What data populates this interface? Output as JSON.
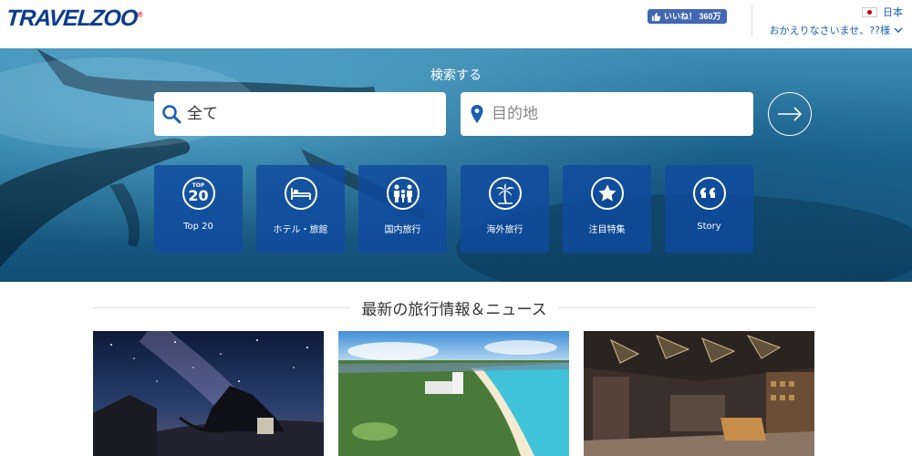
{
  "header": {
    "logo_text": "TRAVELZOO",
    "logo_mark": "®",
    "fb_like": "いいね！ 360万",
    "country": "日本",
    "welcome": "おかえりなさいませ、??様"
  },
  "hero": {
    "search_label": "検索する",
    "keyword_placeholder": "全て",
    "destination_placeholder": "目的地",
    "tiles": [
      {
        "label": "Top 20",
        "icon": "top20-icon",
        "icon_text_top": "TOP",
        "icon_text_num": "20"
      },
      {
        "label": "ホテル・旅館",
        "icon": "bed-icon"
      },
      {
        "label": "国内旅行",
        "icon": "family-icon"
      },
      {
        "label": "海外旅行",
        "icon": "palm-tree-icon"
      },
      {
        "label": "注目特集",
        "icon": "star-icon"
      },
      {
        "label": "Story",
        "icon": "quote-icon"
      }
    ]
  },
  "news": {
    "title": "最新の旅行情報＆ニュース",
    "cards": [
      {
        "image": "starry-night-hammock-photo",
        "caption": ""
      },
      {
        "image": "okinawa-beach-resort-aerial-photo",
        "caption": ""
      },
      {
        "image": "hotel-lobby-interior-photo",
        "caption": ""
      }
    ]
  },
  "colors": {
    "brand_blue": "#0b3c8c",
    "tile_blue": "#0f4ba0",
    "link_blue": "#1a5fb4",
    "facebook_blue": "#4267b2"
  }
}
